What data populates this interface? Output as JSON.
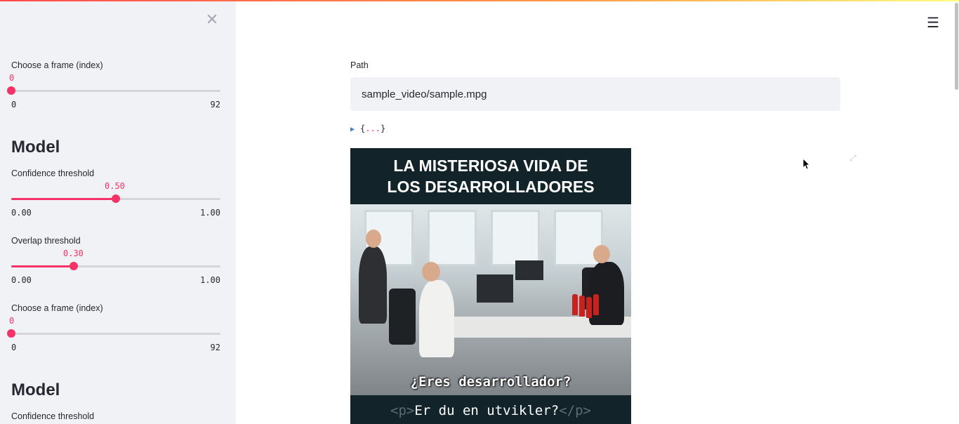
{
  "colors": {
    "accent": "#f63366",
    "sidebar_bg": "#f0f2f6",
    "image_banner": "#12232a"
  },
  "sidebar": {
    "close_icon": "close-icon",
    "frame_slider_1": {
      "label": "Choose a frame (index)",
      "value": "0",
      "min": "0",
      "max": "92",
      "fraction": 0.0
    },
    "model_heading_1": "Model",
    "confidence_slider": {
      "label": "Confidence threshold",
      "value": "0.50",
      "min": "0.00",
      "max": "1.00",
      "fraction": 0.5
    },
    "overlap_slider": {
      "label": "Overlap threshold",
      "value": "0.30",
      "min": "0.00",
      "max": "1.00",
      "fraction": 0.3
    },
    "frame_slider_2": {
      "label": "Choose a frame (index)",
      "value": "0",
      "min": "0",
      "max": "92",
      "fraction": 0.0
    },
    "model_heading_2": "Model",
    "confidence_label_2": "Confidence threshold"
  },
  "main": {
    "menu_icon": "hamburger-menu-icon",
    "path": {
      "label": "Path",
      "value": "sample_video/sample.mpg"
    },
    "json_viewer": {
      "open": "{",
      "dots": "...",
      "close": "}"
    },
    "image": {
      "title_line1": "LA MISTERIOSA VIDA DE",
      "title_line2": "LOS DESARROLLADORES",
      "subtitle_es": "¿Eres desarrollador?",
      "subtitle_tag_open": "<p>",
      "subtitle_no": "Er du en utvikler?",
      "subtitle_tag_close": "</p>"
    },
    "fullscreen_icon": "fullscreen-icon"
  }
}
